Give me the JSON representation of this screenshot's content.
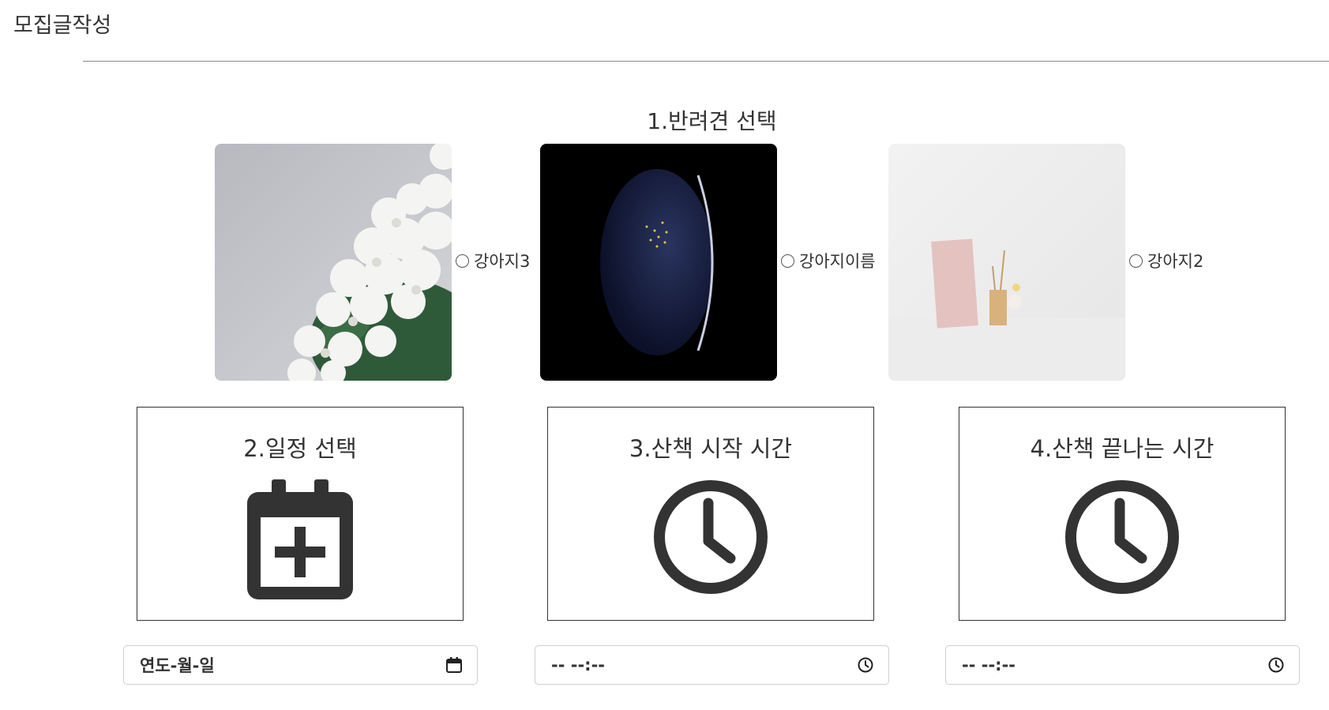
{
  "page": {
    "title": "모집글작성"
  },
  "section1": {
    "title": "1.반려견 선택",
    "dogs": [
      {
        "name": "강아지3",
        "photo": "white-flowers-photo",
        "selected": false
      },
      {
        "name": "강아지이름",
        "photo": "earth-at-night-photo",
        "selected": false
      },
      {
        "name": "강아지2",
        "photo": "desk-stationery-photo",
        "selected": false
      }
    ]
  },
  "cards": [
    {
      "title": "2.일정 선택",
      "icon": "calendar-plus-icon"
    },
    {
      "title": "3.산책 시작 시간",
      "icon": "clock-icon"
    },
    {
      "title": "4.산책 끝나는 시간",
      "icon": "clock-icon"
    }
  ],
  "inputs": {
    "date": {
      "value": "연도-월-일",
      "icon": "calendar-icon"
    },
    "start_time": {
      "value": "-- --:--",
      "icon": "clock-icon"
    },
    "end_time": {
      "value": "-- --:--",
      "icon": "clock-icon"
    }
  },
  "colors": {
    "text": "#333333",
    "border": "#333333",
    "input_border": "#cfcfcf"
  }
}
